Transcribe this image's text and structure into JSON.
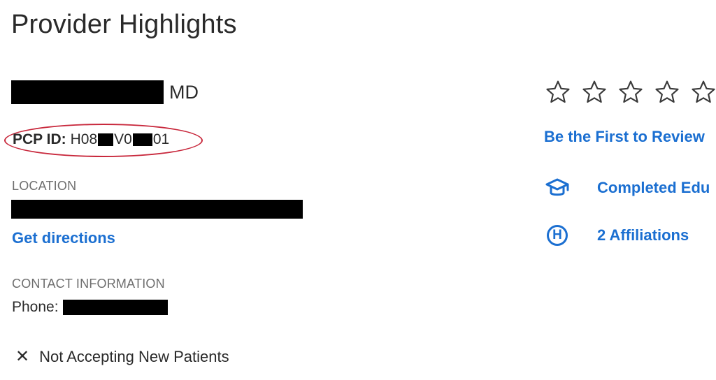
{
  "page": {
    "title": "Provider Highlights"
  },
  "provider": {
    "name_suffix": "MD",
    "pcp_label": "PCP ID:",
    "pcp_part1": "H08",
    "pcp_part2": "V0",
    "pcp_part3": "01"
  },
  "location": {
    "label": "LOCATION",
    "directions_link": "Get directions"
  },
  "contact": {
    "label": "CONTACT INFORMATION",
    "phone_label": "Phone:"
  },
  "status": {
    "icon": "close-icon",
    "text": "Not Accepting New Patients"
  },
  "rating": {
    "stars_filled": 0,
    "stars_total": 5,
    "review_link": "Be the First to Review"
  },
  "features": [
    {
      "icon": "graduation-cap-icon",
      "label": "Completed Edu"
    },
    {
      "icon": "hospital-icon",
      "glyph": "H",
      "label": "2 Affiliations"
    }
  ],
  "colors": {
    "link": "#1b6fd1",
    "annotation_ellipse": "#c8283c",
    "redaction": "#000000"
  }
}
